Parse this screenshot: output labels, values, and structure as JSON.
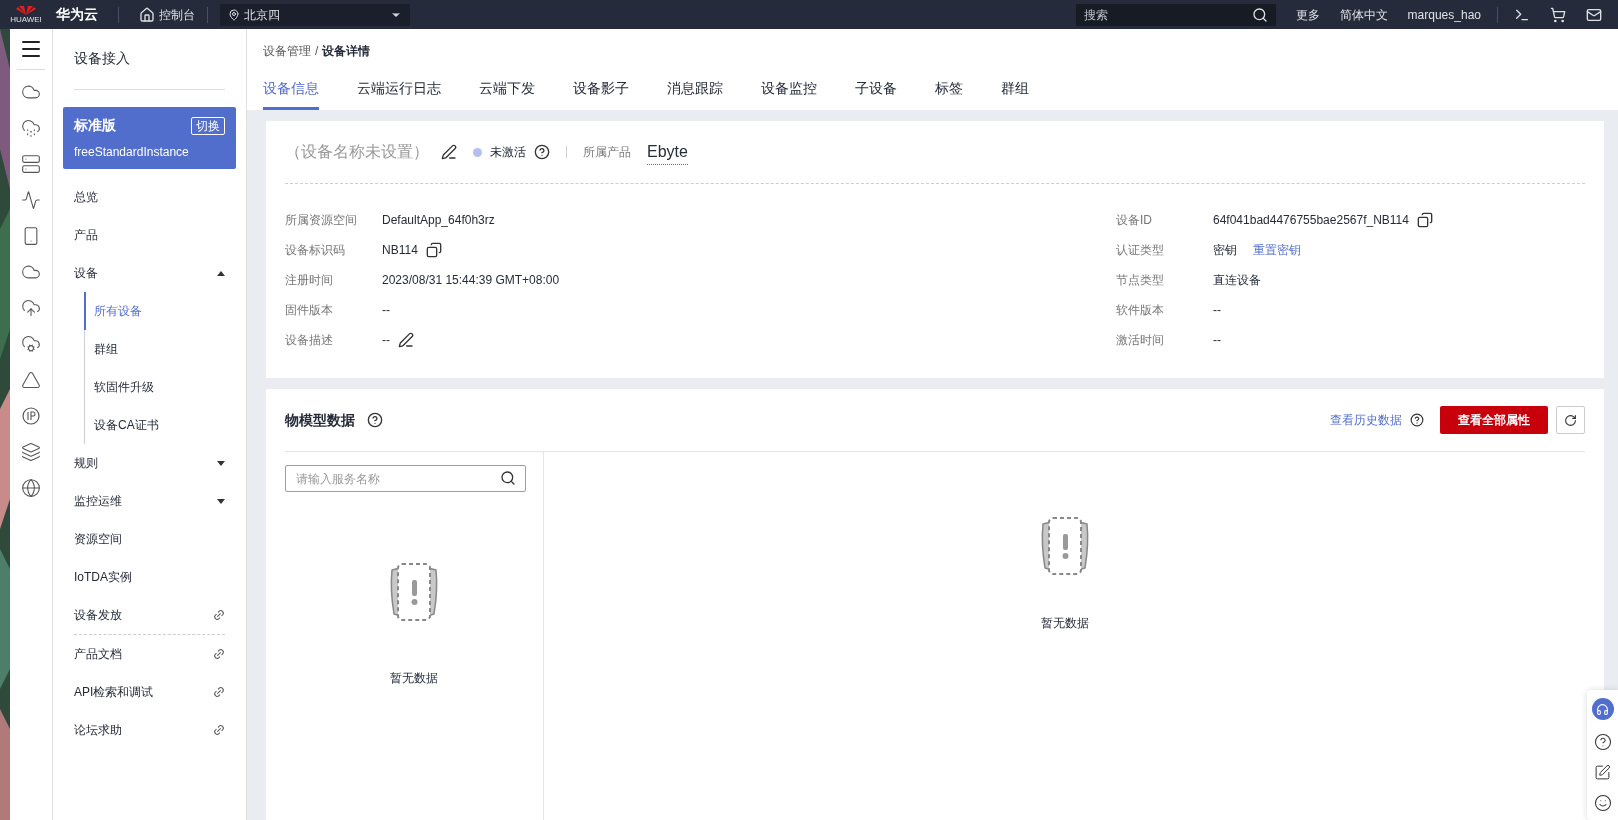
{
  "topbar": {
    "logo_text": "HUAWEI",
    "brand": "华为云",
    "console": "控制台",
    "region": "北京四",
    "search": {
      "placeholder": "搜索"
    },
    "links": [
      "更多",
      "简体中文",
      "marques_hao"
    ]
  },
  "sidebar": {
    "title": "设备接入",
    "instance": {
      "edition": "标准版",
      "switch": "切换",
      "name": "freeStandardInstance"
    },
    "items": [
      {
        "label": "总览",
        "kind": "plain",
        "selected": false
      },
      {
        "label": "产品",
        "kind": "plain",
        "selected": false
      },
      {
        "label": "设备",
        "kind": "group",
        "expanded": true,
        "selected": false,
        "children": [
          {
            "label": "所有设备",
            "selected": true
          },
          {
            "label": "群组",
            "selected": false
          },
          {
            "label": "软固件升级",
            "selected": false
          },
          {
            "label": "设备CA证书",
            "selected": false
          }
        ]
      },
      {
        "label": "规则",
        "kind": "group",
        "expanded": false,
        "selected": false
      },
      {
        "label": "监控运维",
        "kind": "group",
        "expanded": false,
        "selected": false
      },
      {
        "label": "资源空间",
        "kind": "plain",
        "selected": false
      },
      {
        "label": "IoTDA实例",
        "kind": "plain",
        "selected": false
      },
      {
        "label": "设备发放",
        "kind": "link",
        "selected": false
      }
    ],
    "doc_links": [
      "产品文档",
      "API检索和调试",
      "论坛求助"
    ]
  },
  "breadcrumb": {
    "parent": "设备管理",
    "separator": "/",
    "current": "设备详情"
  },
  "tabs": [
    {
      "label": "设备信息",
      "selected": true
    },
    {
      "label": "云端运行日志",
      "selected": false
    },
    {
      "label": "云端下发",
      "selected": false
    },
    {
      "label": "设备影子",
      "selected": false
    },
    {
      "label": "消息跟踪",
      "selected": false
    },
    {
      "label": "设备监控",
      "selected": false
    },
    {
      "label": "子设备",
      "selected": false
    },
    {
      "label": "标签",
      "selected": false
    },
    {
      "label": "群组",
      "selected": false
    }
  ],
  "device": {
    "name": "（设备名称未设置）",
    "status": "未激活",
    "activated": false,
    "product_label": "所属产品",
    "product": "Ebyte",
    "fields_left": [
      {
        "label": "所属资源空间",
        "value": "DefaultApp_64f0h3rz",
        "kind": "text"
      },
      {
        "label": "设备标识码",
        "value": "NB114",
        "kind": "copy"
      },
      {
        "label": "注册时间",
        "value": "2023/08/31 15:44:39 GMT+08:00",
        "kind": "text"
      },
      {
        "label": "固件版本",
        "value": "--",
        "kind": "text"
      },
      {
        "label": "设备描述",
        "value": "--",
        "kind": "edit"
      }
    ],
    "fields_right": [
      {
        "label": "设备ID",
        "value": "64f041bad4476755bae2567f_NB114",
        "kind": "copy"
      },
      {
        "label": "认证类型",
        "value": "密钥",
        "kind": "link",
        "link": "重置密钥"
      },
      {
        "label": "节点类型",
        "value": "直连设备",
        "kind": "text"
      },
      {
        "label": "软件版本",
        "value": "--",
        "kind": "text"
      },
      {
        "label": "激活时间",
        "value": "--",
        "kind": "text"
      }
    ]
  },
  "model_data": {
    "title": "物模型数据",
    "history_link": "查看历史数据",
    "view_all_button": "查看全部属性",
    "search": {
      "placeholder": "请输入服务名称"
    },
    "empty_left": "暂无数据",
    "empty_right": "暂无数据"
  }
}
